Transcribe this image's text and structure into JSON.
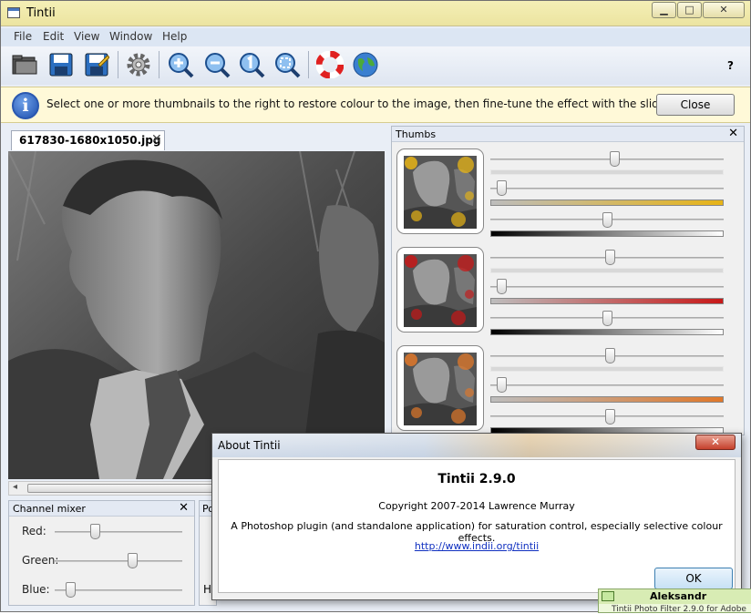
{
  "window": {
    "title": "Tintii",
    "minimize": "▁",
    "maximize": "□",
    "close": "✕"
  },
  "menu": [
    "File",
    "Edit",
    "View",
    "Window",
    "Help"
  ],
  "toolbar": {
    "icons": [
      "open-folder-icon",
      "save-icon",
      "save-as-icon",
      "settings-gear-icon",
      "zoom-in-icon",
      "zoom-out-icon",
      "zoom-actual-size-icon",
      "zoom-fit-icon",
      "help-lifebuoy-icon",
      "website-globe-icon"
    ],
    "whats_this": "?"
  },
  "infobar": {
    "icon": "i",
    "message": "Select one or more thumbnails to the right to restore colour to the image, then fine-tune the effect with the sliders.",
    "close_label": "Close"
  },
  "image_tab": {
    "label": "617830-1680x1050.jpg",
    "close": "✕"
  },
  "thumbs_panel": {
    "title": "Thumbs",
    "close": "✕",
    "thumbs": [
      {
        "name": "yellow",
        "color": "#e7b416",
        "hue": 0.53,
        "saturation": 0.02,
        "lightness": 0.5
      },
      {
        "name": "red",
        "color": "#c81818",
        "hue": 0.51,
        "saturation": 0.02,
        "lightness": 0.5
      },
      {
        "name": "orange",
        "color": "#e0782a",
        "hue": 0.51,
        "saturation": 0.02,
        "lightness": 0.51
      }
    ]
  },
  "channel_mixer": {
    "title": "Channel mixer",
    "close": "✕",
    "channels": [
      {
        "label": "Red:",
        "value": 0.3
      },
      {
        "label": "Green:",
        "value": 0.59
      },
      {
        "label": "Blue:",
        "value": 0.11
      }
    ]
  },
  "post_panel": {
    "title": "Po",
    "label": "H"
  },
  "about_dialog": {
    "title": "About Tintii",
    "close": "✕",
    "heading": "Tintii 2.9.0",
    "copyright": "Copyright 2007-2014 Lawrence Murray",
    "description": "A Photoshop plugin (and standalone application) for saturation control, especially selective colour effects.",
    "link": "http://www.indii.org/tintii",
    "ok_label": "OK"
  },
  "notification": {
    "name": "Aleksandr",
    "text": "Tintii Photo Filter 2.9.0 for Adobe"
  }
}
